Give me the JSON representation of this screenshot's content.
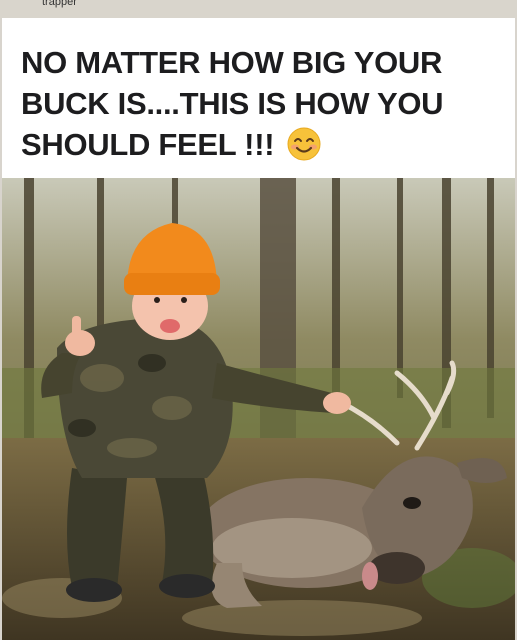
{
  "post": {
    "username": "trapper",
    "caption": "NO MATTER HOW BIG YOUR BUCK IS....THIS IS HOW YOU SHOULD FEEL !!!",
    "caption_emoji": "smiling-face-with-smiling-eyes-icon"
  },
  "colors": {
    "header_bg": "#d9d5cc",
    "card_bg": "#ffffff",
    "caption_text": "#1d1d1f",
    "beanie_orange": "#f28a1c"
  }
}
